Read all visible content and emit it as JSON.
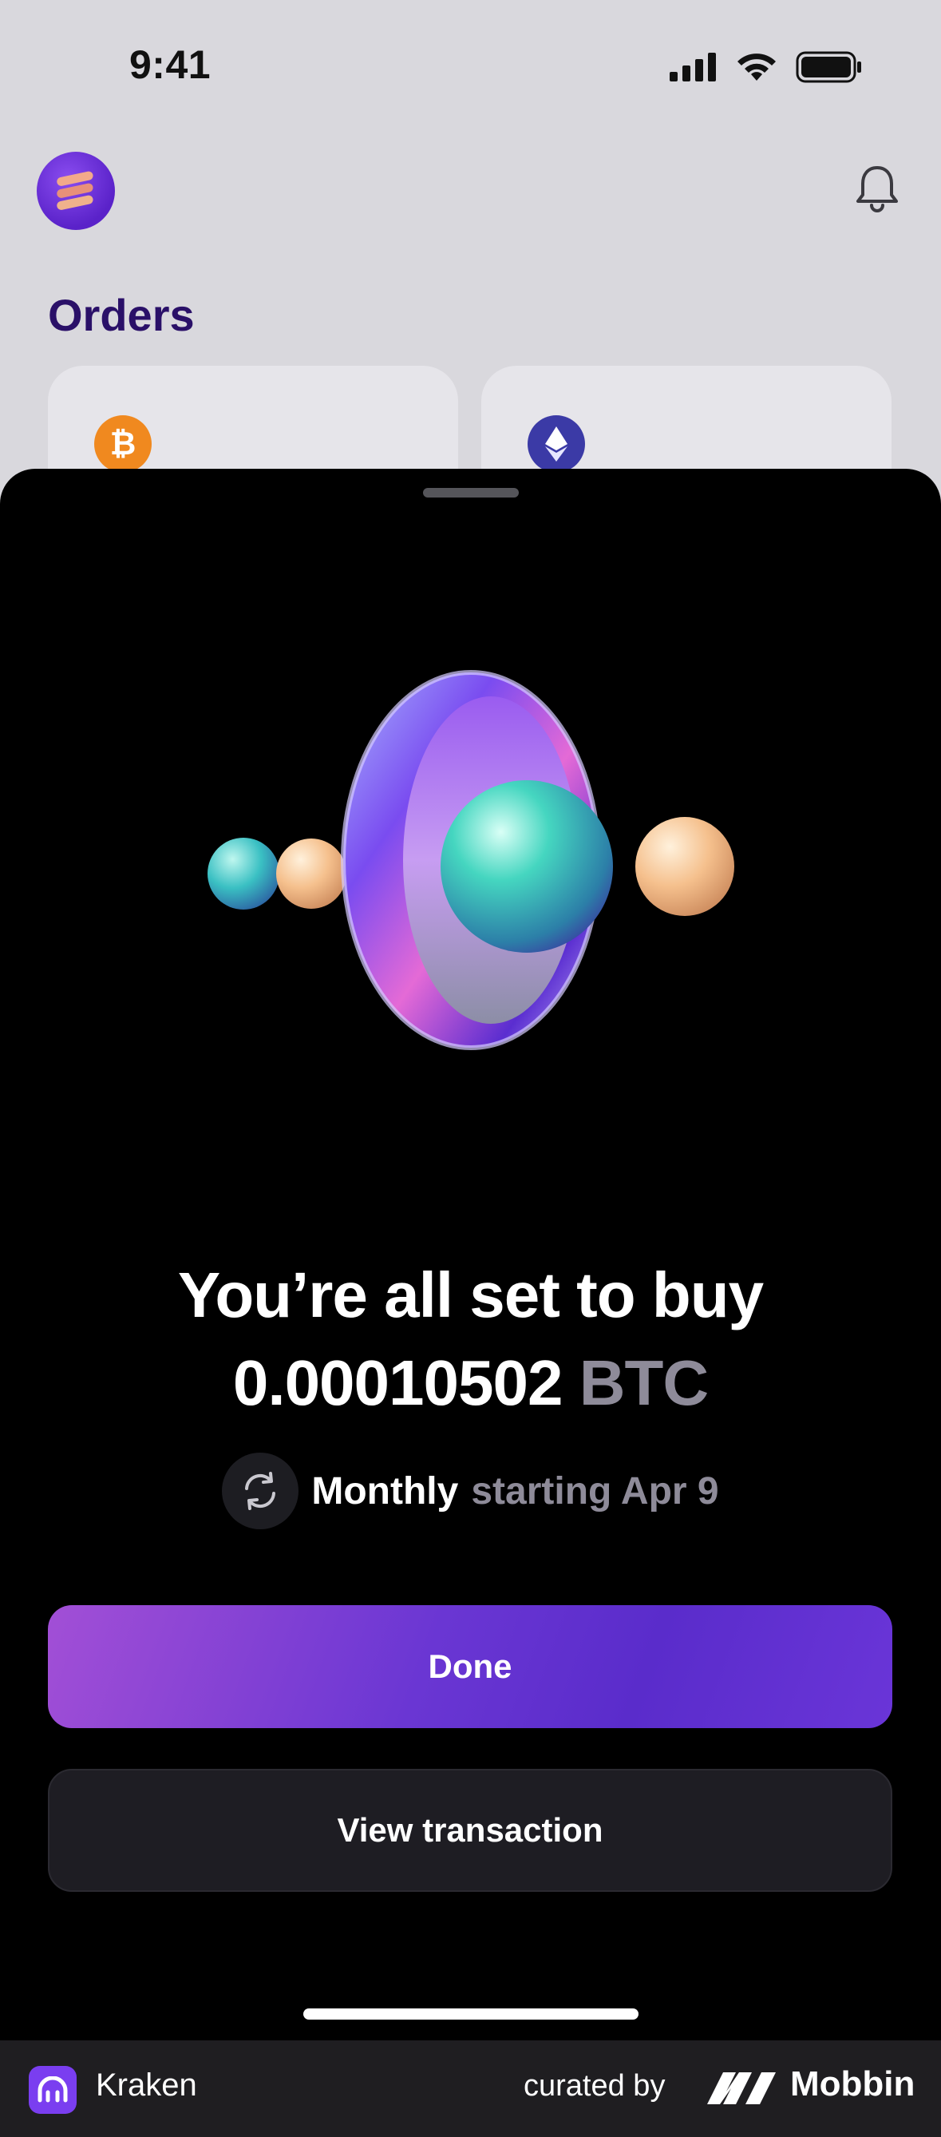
{
  "status_bar": {
    "time": "9:41"
  },
  "header": {
    "avatar_icon": "layers-icon",
    "bell_icon": "bell-icon"
  },
  "orders": {
    "title": "Orders",
    "cards": [
      {
        "coin_icon": "bitcoin-icon",
        "coin_glyph": "₿"
      },
      {
        "coin_icon": "ethereum-icon"
      }
    ]
  },
  "confirmation": {
    "headline_line1": "You’re all set to buy",
    "amount": "0.00010502",
    "currency": "BTC",
    "frequency": "Monthly",
    "start": "starting Apr 9",
    "done_label": "Done",
    "view_label": "View transaction"
  },
  "footer": {
    "app_name": "Kraken",
    "curated_by": "curated by",
    "brand": "Mobbin"
  },
  "colors": {
    "accent": "#6a36d3",
    "title": "#2a1068",
    "muted": "#8e8b99"
  }
}
